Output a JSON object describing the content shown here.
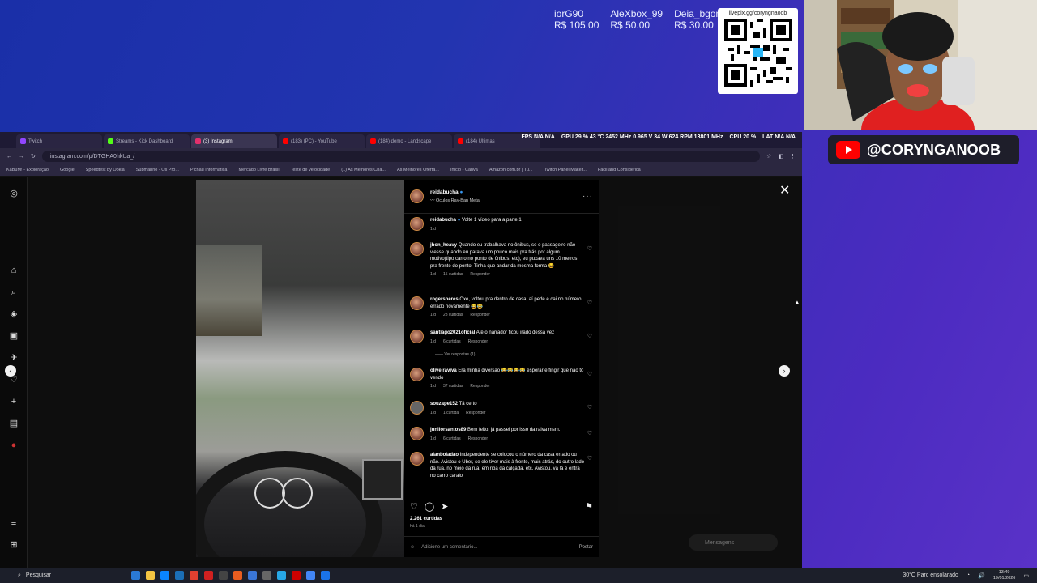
{
  "donors": [
    {
      "name": "iorG90",
      "amount": "R$ 105.00"
    },
    {
      "name": "AleXbox_99",
      "amount": "R$ 50.00"
    },
    {
      "name": "Deia_bgon",
      "amount": "R$ 30.00"
    }
  ],
  "qr_label": "livepix.gg/coryngnaoob",
  "youtube_handle": "@CORYNGANOOB",
  "browser": {
    "tabs": [
      {
        "label": "Twitch",
        "color": "#9146ff",
        "active": false
      },
      {
        "label": "Streams - Kick Dashboard",
        "color": "#53fc18",
        "active": false
      },
      {
        "label": "(3) Instagram",
        "color": "#e1306c",
        "active": true
      },
      {
        "label": "(183) (PC) - YouTube",
        "color": "#ff0000",
        "active": false
      },
      {
        "label": "(184) demo - Landscape",
        "color": "#ff0000",
        "active": false
      },
      {
        "label": "(184) Ultimas",
        "color": "#ff0000",
        "active": false
      }
    ],
    "perf": {
      "fps": "FPS  N/A  N/A",
      "gpu": "GPU 29 % 43 °C 2452 MHz 0.965 V 34 W 624 RPM 13801 MHz",
      "cpu": "CPU 20 %",
      "lat": "LAT N/A N/A"
    },
    "url": "instagram.com/p/DTGHA0hkUa_/",
    "bookmarks": [
      "KaBuM! - Exploração",
      "Google",
      "Speedtest by Ookla",
      "Submarino - Os Pro...",
      "Pichau Informática",
      "Mercado Livre Brasil",
      "Teste de velocidade",
      "(1) As Melhores Cha...",
      "As Melhores Oferta...",
      "Início - Canva",
      "Amazon.com.br | Tu...",
      "Twitch Panel Maker...",
      "Fácil and Considérica"
    ]
  },
  "post": {
    "author": "reidabucha",
    "subtitle": "Óculos Ray-Ban Meta",
    "caption": "Volte 1 vídeo para a parte 1",
    "caption_time": "1 d",
    "comments": [
      {
        "user": "jhon_heavy",
        "text": "Quando eu trabalhava no ônibus, se o passageiro não viesse quando eu parava um pouco mais pra trás por algum motivo(tipo carro no ponto de ônibus, etc), eu puxava uns 10 metros pra frente do ponto. Tinha que andar da mesma forma 😂",
        "time": "1 d",
        "likes": "15 curtidas",
        "reply": "Responder"
      },
      {
        "user": "rogersneres",
        "text": "Oxe, voltou pra dentro de casa, aí pede e cai no número errado novamente 😂😂",
        "time": "1 d",
        "likes": "28 curtidas",
        "reply": "Responder"
      },
      {
        "user": "santiago2021oficial",
        "text": "Até o narrador ficou irado dessa vez",
        "time": "1 d",
        "likes": "6 curtidas",
        "reply": "Responder"
      },
      {
        "user": "oliveiraviva",
        "text": "Era minha diversão 😂😂😂😂 esperar e fingir que não tô vendo",
        "time": "1 d",
        "likes": "37 curtidas",
        "reply": "Responder"
      },
      {
        "user": "souzape152",
        "text": "Tá certo",
        "time": "1 d",
        "likes": "1 curtida",
        "reply": "Responder"
      },
      {
        "user": "juniiorsantos89",
        "text": "Bem feito, já passei por isso da raiva msm.",
        "time": "1 d",
        "likes": "6 curtidas",
        "reply": "Responder"
      },
      {
        "user": "alanboladao",
        "text": "Independente se colocou o número da casa errado ou não. Avistou o Uber, se ele tiver mais à frente, mais atrás, do outro lado da rua, no meio da rua, em riba da calçada, etc. Avistou, vá lá e entra no carro caraio",
        "time": "",
        "likes": "",
        "reply": ""
      }
    ],
    "view_replies": "Ver respostas (1)",
    "likes": "2.261 curtidas",
    "ago": "há 1 dia",
    "comment_placeholder": "Adicione um comentário...",
    "post_button": "Postar"
  },
  "messages_button": "Mensagens",
  "taskbar": {
    "search": "Pesquisar",
    "weather": "30°C  Parc ensolarado",
    "time": "13:49",
    "date": "19/01/2026"
  }
}
